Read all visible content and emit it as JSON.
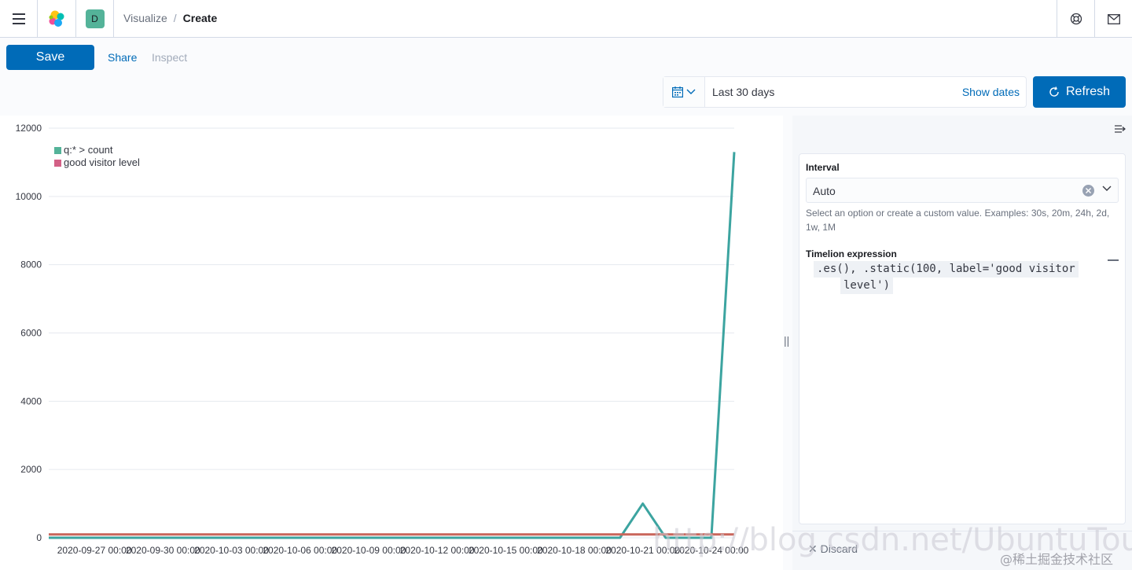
{
  "header": {
    "space_initial": "D",
    "breadcrumbs": [
      "Visualize",
      "Create"
    ]
  },
  "topnav": {
    "save_label": "Save",
    "share_label": "Share",
    "inspect_label": "Inspect"
  },
  "datepicker": {
    "range": "Last 30 days",
    "show_dates": "Show dates",
    "refresh_label": "Refresh"
  },
  "sidebar": {
    "interval_label": "Interval",
    "interval_value": "Auto",
    "interval_help": "Select an option or create a custom value. Examples: 30s, 20m, 24h, 2d, 1w, 1M",
    "expression_label": "Timelion expression",
    "expression_line1": ".es(), .static(100, label='good visitor",
    "expression_line2": "level')",
    "discard_label": "Discard"
  },
  "watermark": {
    "url": "http://blog.csdn.net/UbuntuTouch",
    "community": "@稀土掘金技术社区"
  },
  "chart_data": {
    "type": "line",
    "ylim": [
      0,
      12000
    ],
    "yticks": [
      "0",
      "2000",
      "4000",
      "6000",
      "8000",
      "10000",
      "12000"
    ],
    "xticks": [
      "2020-09-27 00:00",
      "2020-09-30 00:00",
      "2020-10-03 00:00",
      "2020-10-06 00:00",
      "2020-10-09 00:00",
      "2020-10-12 00:00",
      "2020-10-15 00:00",
      "2020-10-18 00:00",
      "2020-10-21 00:00",
      "2020-10-24 00:00"
    ],
    "legend": [
      {
        "name": "q:* > count",
        "color": "#54b399"
      },
      {
        "name": "good visitor level",
        "color": "#d36086"
      }
    ],
    "series": [
      {
        "name": "q:* > count",
        "color": "#3ca4a0",
        "x": [
          "2020-09-25",
          "2020-09-26",
          "2020-09-27",
          "2020-09-28",
          "2020-09-29",
          "2020-09-30",
          "2020-10-01",
          "2020-10-02",
          "2020-10-03",
          "2020-10-04",
          "2020-10-05",
          "2020-10-06",
          "2020-10-07",
          "2020-10-08",
          "2020-10-09",
          "2020-10-10",
          "2020-10-11",
          "2020-10-12",
          "2020-10-13",
          "2020-10-14",
          "2020-10-15",
          "2020-10-16",
          "2020-10-17",
          "2020-10-18",
          "2020-10-19",
          "2020-10-20",
          "2020-10-21",
          "2020-10-22",
          "2020-10-23",
          "2020-10-24",
          "2020-10-25"
        ],
        "values": [
          0,
          0,
          0,
          0,
          0,
          0,
          0,
          0,
          0,
          0,
          0,
          0,
          0,
          0,
          0,
          0,
          0,
          0,
          0,
          0,
          0,
          0,
          0,
          0,
          0,
          0,
          1000,
          0,
          0,
          0,
          11300
        ]
      },
      {
        "name": "good visitor level",
        "color": "#c9665b",
        "x": [
          "2020-09-25",
          "2020-10-25"
        ],
        "values": [
          100,
          100
        ]
      }
    ]
  }
}
